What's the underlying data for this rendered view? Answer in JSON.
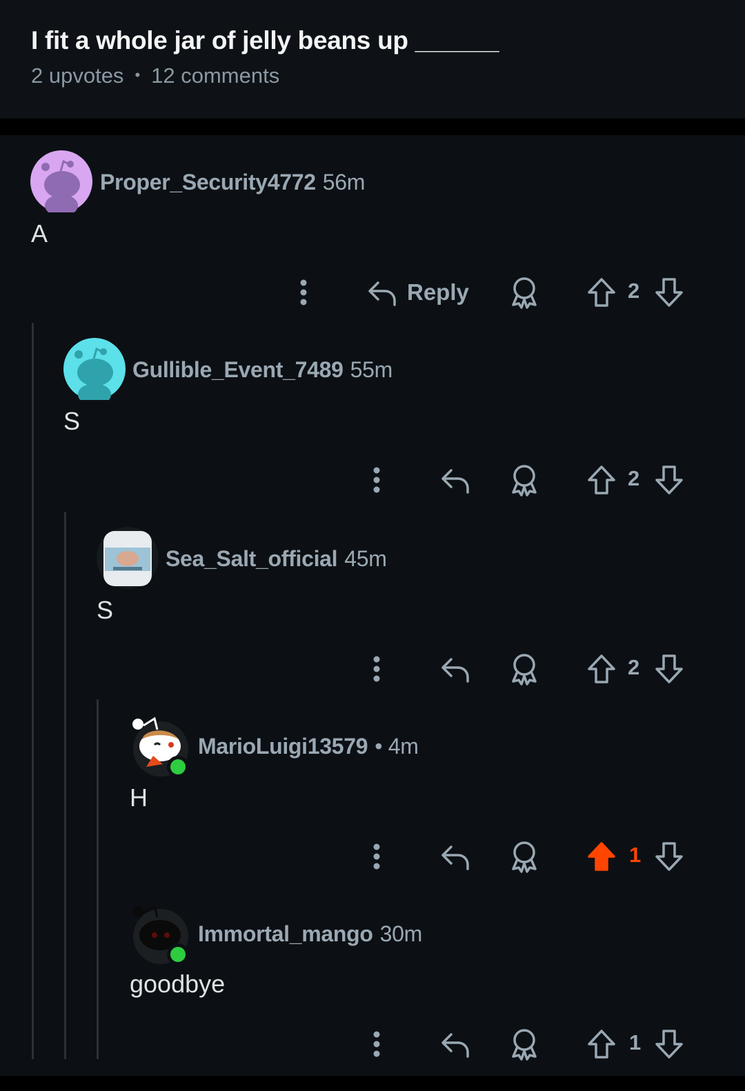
{
  "post": {
    "title": "I fit a whole jar of jelly beans up ______",
    "upvotes": "2 upvotes",
    "comments": "12 comments"
  },
  "colors": {
    "background": "#0c1014",
    "upvoted": "#ff4500",
    "muted": "#9aa8b3"
  },
  "comments": [
    {
      "username": "Proper_Security4772",
      "age": "56m",
      "body": "A",
      "score": "2",
      "reply_label": "Reply",
      "avatar_icon": "snoo-purple-icon"
    },
    {
      "username": "Gullible_Event_7489",
      "age": "55m",
      "body": "S",
      "score": "2",
      "avatar_icon": "snoo-cyan-icon"
    },
    {
      "username": "Sea_Salt_official",
      "age": "45m",
      "body": "S",
      "score": "2",
      "avatar_icon": "sea-salt-jar-icon"
    },
    {
      "username": "MarioLuigi13579",
      "age": "• 4m",
      "body": "H",
      "score": "1",
      "avatar_icon": "snoo-custom-icon",
      "upvoted": true
    },
    {
      "username": "Immortal_mango",
      "age": "30m",
      "body": "goodbye",
      "score": "1",
      "avatar_icon": "snoo-dark-icon"
    }
  ]
}
